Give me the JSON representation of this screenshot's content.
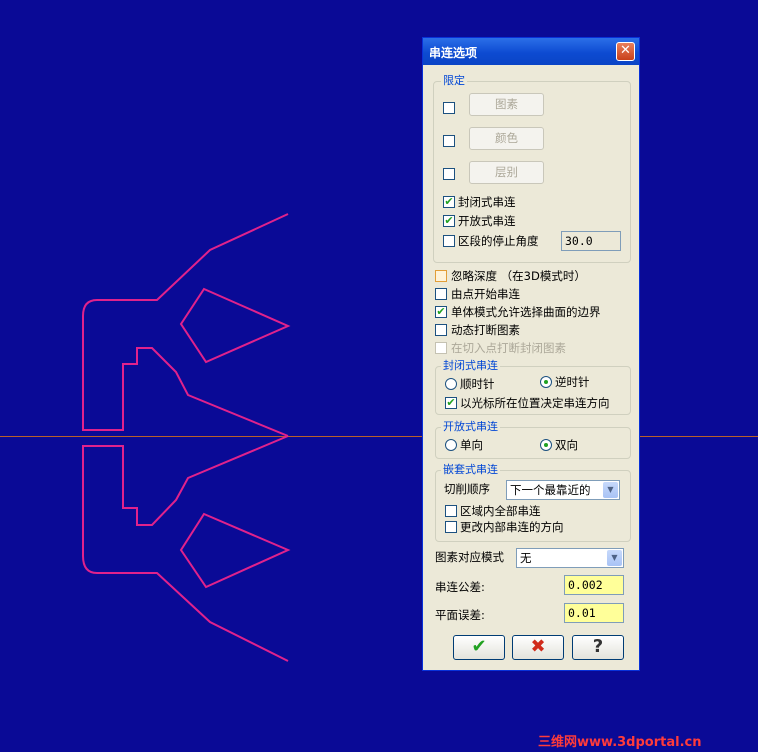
{
  "dialog": {
    "title": "串连选项",
    "close_glyph": "✕",
    "limit_group": {
      "title": "限定",
      "buttons": [
        "图素",
        "颜色",
        "层别"
      ],
      "closed_chain": "封闭式串连",
      "open_chain": "开放式串连",
      "stop_angle_label": "区段的停止角度",
      "stop_angle_value": "30.0"
    },
    "options": {
      "ignore_depth": "忽略深度 （在3D模式时）",
      "start_from_point": "由点开始串连",
      "allow_surface_boundary": "单体模式允许选择曲面的边界",
      "dynamic_break": "动态打断图素",
      "break_closed_at_entry": "在切入点打断封闭图素"
    },
    "closed_group": {
      "title": "封闭式串连",
      "cw": "顺时针",
      "ccw": "逆时针",
      "cursor_direction": "以光标所在位置决定串连方向"
    },
    "open_group": {
      "title": "开放式串连",
      "one_way": "单向",
      "two_way": "双向"
    },
    "nested_group": {
      "title": "嵌套式串连",
      "cut_order_label": "切削顺序",
      "cut_order_value": "下一个最靠近的",
      "all_in_region": "区域内全部串连",
      "change_inner_direction": "更改内部串连的方向"
    },
    "entity_match_label": "图素对应模式",
    "entity_match_value": "无",
    "chain_tolerance_label": "串连公差:",
    "chain_tolerance_value": "0.002",
    "plane_error_label": "平面误差:",
    "plane_error_value": "0.01",
    "ok_glyph": "✔",
    "cancel_glyph": "✖",
    "help_glyph": "?"
  },
  "watermark": "三维网www.3dportal.cn",
  "colors": {
    "background": "#0a0a96",
    "geometry": "#e0228c",
    "axis": "#b8602a",
    "dialog_face": "#ece9d8",
    "title_blue": "#0d4bd2",
    "group_title": "#0046d5",
    "check_green": "#21a121"
  },
  "icons": [
    "close-icon",
    "checkmark-icon",
    "cross-icon",
    "help-icon"
  ]
}
